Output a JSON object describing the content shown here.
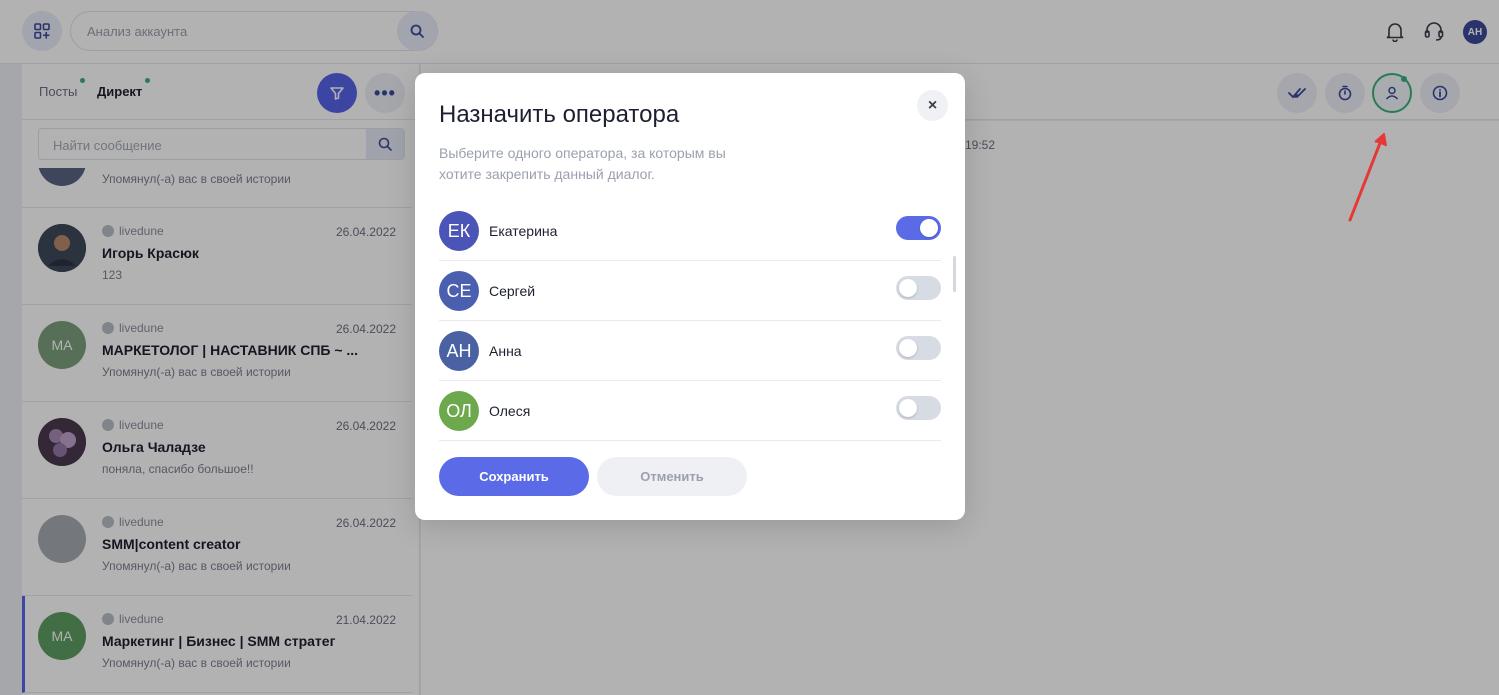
{
  "header": {
    "search_placeholder": "Анализ аккаунта",
    "user_initials": "АН"
  },
  "left": {
    "tabs": [
      {
        "label": "Посты",
        "active": false,
        "has_dot": true
      },
      {
        "label": "Директ",
        "active": true,
        "has_dot": true
      }
    ],
    "message_search_placeholder": "Найти сообщение",
    "partial_preview": "Упомянул(-а) вас в своей истории",
    "conversations": [
      {
        "source": "livedune",
        "date": "26.04.2022",
        "name": "Игорь Красюк",
        "preview": "123",
        "avatar_initials": "",
        "avatar_color": "#5a4a3e"
      },
      {
        "source": "livedune",
        "date": "26.04.2022",
        "name": "МАРКЕТОЛОГ | НАСТАВНИК СПБ ~ ...",
        "preview": "Упомянул(-а) вас в своей истории",
        "avatar_initials": "МА",
        "avatar_color": "#7ba07c"
      },
      {
        "source": "livedune",
        "date": "26.04.2022",
        "name": "Ольга Чаладзе",
        "preview": "поняла, спасибо большое!!",
        "avatar_initials": "",
        "avatar_color": "#8a6a8e"
      },
      {
        "source": "livedune",
        "date": "26.04.2022",
        "name": "SMM|content creator",
        "preview": "Упомянул(-а) вас в своей истории",
        "avatar_initials": "",
        "avatar_color": "#a7acb3"
      },
      {
        "source": "livedune",
        "date": "21.04.2022",
        "name": "Маркетинг | Бизнес | SMM стратег",
        "preview": "Упомянул(-а) вас в своей истории",
        "avatar_initials": "МА",
        "avatar_color": "#5e9e62"
      }
    ]
  },
  "chat": {
    "time_stub": "19:52"
  },
  "modal": {
    "title": "Назначить оператора",
    "description": "Выберите одного оператора, за которым вы хотите закрепить данный диалог.",
    "close_label": "×",
    "operators": [
      {
        "initials": "ЕК",
        "name": "Екатерина",
        "color": "#4b55b8",
        "enabled": true
      },
      {
        "initials": "СЕ",
        "name": "Сергей",
        "color": "#4b5fb1",
        "enabled": false
      },
      {
        "initials": "АН",
        "name": "Анна",
        "color": "#4a62a3",
        "enabled": false
      },
      {
        "initials": "ОЛ",
        "name": "Олеся",
        "color": "#6ea84d",
        "enabled": false
      }
    ],
    "save_label": "Сохранить",
    "cancel_label": "Отменить"
  },
  "colors": {
    "accent": "#5b6be8",
    "online": "#3cb07a",
    "annotation": "#e53935"
  }
}
